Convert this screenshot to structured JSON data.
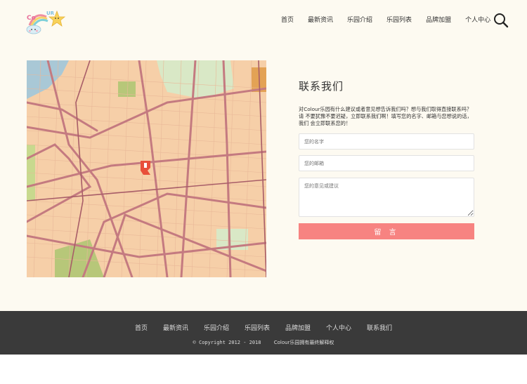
{
  "header": {
    "logo_text": "Colour",
    "nav": [
      "首页",
      "最新资讯",
      "乐园介绍",
      "乐园列表",
      "品牌加盟",
      "个人中心"
    ],
    "search_icon": "search-icon"
  },
  "contact": {
    "title": "联系我们",
    "intro": "对Colour乐园有什么建议或者意见想告诉我们吗？想与我们取得直接联系吗？请 不要犹豫不要迟疑，立即联系我们啊！填写您的名字、邮箱与您想说的话，我们 会立即联系您的！",
    "name_placeholder": "您的名字",
    "email_placeholder": "您的邮箱",
    "message_placeholder": "您的意见或建议",
    "submit_label": "留 言"
  },
  "map": {
    "marker_icon": "map-pin-icon"
  },
  "footer": {
    "nav": [
      "首页",
      "最新资讯",
      "乐园介绍",
      "乐园列表",
      "品牌加盟",
      "个人中心",
      "联系我们"
    ],
    "copyright": "© Copyright 2012 - 2018",
    "rights": "Colour乐园拥有最终解释权"
  },
  "colors": {
    "background": "#fdfaf1",
    "accent": "#f78381",
    "footer": "#3a3a3a"
  }
}
